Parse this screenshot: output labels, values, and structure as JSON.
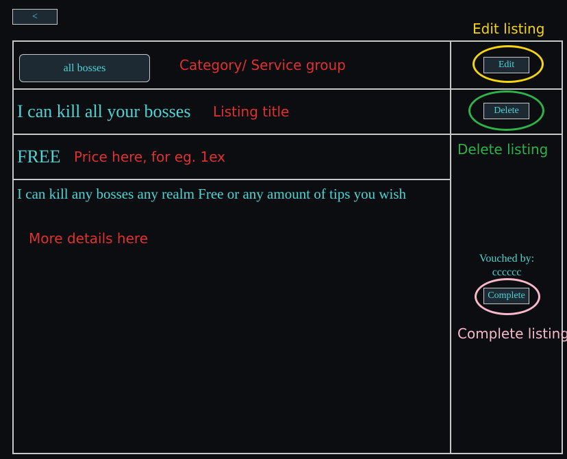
{
  "nav": {
    "back_label": "<"
  },
  "listing": {
    "category": "all bosses",
    "title": "I can kill all your bosses",
    "price": "FREE",
    "description": "I can kill any bosses any realm Free or any amount of tips you wish"
  },
  "actions": {
    "edit_label": "Edit",
    "delete_label": "Delete",
    "complete_label": "Complete"
  },
  "vouch": {
    "label": "Vouched by:",
    "user": "cccccc"
  },
  "annotations": {
    "category": "Category/ Service group",
    "title": "Listing title",
    "price": "Price here, for eg. 1ex",
    "details": "More details here",
    "edit": "Edit listing",
    "delete": "Delete listing",
    "complete": "Complete listing"
  },
  "colors": {
    "background": "#0b0d11",
    "text_teal": "#4fd3d3",
    "border": "#c8c8c8",
    "annotation_red": "#e0312e",
    "annotation_yellow": "#f5d414",
    "annotation_green": "#2fb24a",
    "annotation_pink": "#f7b9c9"
  }
}
